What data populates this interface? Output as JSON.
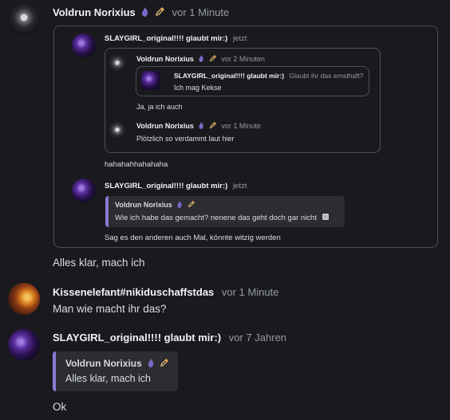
{
  "users": {
    "voldrun": "Voldrun Norixius",
    "slaygirl": "SLAYGIRL_original!!!! glaubt mir:)",
    "kissen": "Kissenelefant#nikiduschaffstdas"
  },
  "icons": {
    "badge": "purple-flame-icon",
    "pencil": "pencil-icon"
  },
  "msg1": {
    "author": "Voldrun Norixius",
    "time": "vor 1 Minute",
    "embed": {
      "author": "SLAYGIRL_original!!!! glaubt mir:)",
      "time": "jetzt",
      "inner": {
        "author": "Voldrun Norixius",
        "time": "vor 2 Minuten",
        "nested": {
          "author": "SLAYGIRL_original!!!! glaubt mir:)",
          "time": "Glaubt ihr das ernsthaft?",
          "text": "Ich mag Kekse"
        },
        "text1": "Ja, ja ich auch",
        "reply": {
          "author": "Voldrun Norixius",
          "time": "vor 1 Minute",
          "text": "Plötzlich so verdammt laut hier"
        }
      },
      "text_after": "hahahahhahahaha",
      "reply2": {
        "author": "SLAYGIRL_original!!!! glaubt mir:)",
        "time": "jetzt",
        "quote": {
          "author": "Voldrun Norixius",
          "text": "Wie ich habe das gemacht? nenene das geht doch gar nicht"
        },
        "text": "Sag es den anderen auch Mal, könnte witzig werden"
      }
    },
    "text": "Alles klar, mach ich"
  },
  "msg2": {
    "author": "Kissenelefant#nikiduschaffstdas",
    "time": "vor 1 Minute",
    "text": "Man wie macht ihr das?"
  },
  "msg3": {
    "author": "SLAYGIRL_original!!!! glaubt mir:)",
    "time": "vor 7 Jahren",
    "quote": {
      "author": "Voldrun Norixius",
      "text": "Alles klar, mach ich"
    },
    "text": "Ok"
  },
  "colors": {
    "background": "#1a1a1e",
    "quote_accent": "#8b7bd8",
    "badge_purple": "#7b68c9"
  }
}
